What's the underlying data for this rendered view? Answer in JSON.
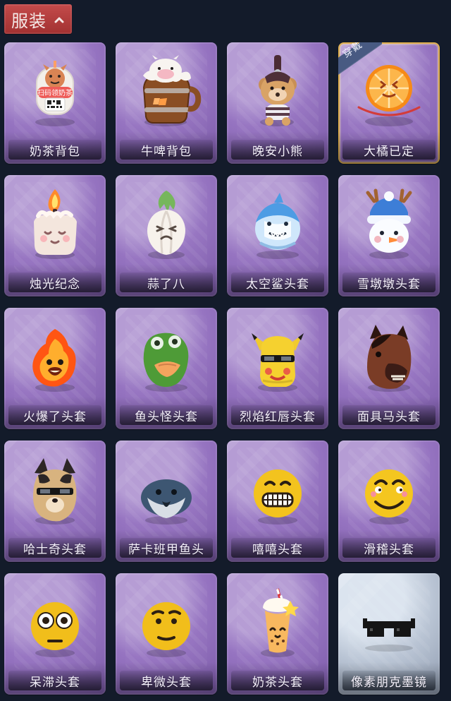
{
  "header": {
    "category_label": "服装",
    "caret_icon": "chevron-up-icon"
  },
  "grid": {
    "items": [
      {
        "label": "奶茶背包",
        "icon": "milk-tea-backpack-icon",
        "overlay_text": "扫码领奶茶"
      },
      {
        "label": "牛啤背包",
        "icon": "cow-beer-backpack-icon"
      },
      {
        "label": "晚安小熊",
        "icon": "bear-keychain-icon"
      },
      {
        "label": "大橘已定",
        "icon": "orange-slice-icon",
        "badge": "穿戴",
        "equipped": true
      },
      {
        "label": "烛光纪念",
        "icon": "candle-icon"
      },
      {
        "label": "蒜了八",
        "icon": "garlic-icon"
      },
      {
        "label": "太空鲨头套",
        "icon": "shark-helmet-icon"
      },
      {
        "label": "雪墩墩头套",
        "icon": "snowman-icon"
      },
      {
        "label": "火爆了头套",
        "icon": "flame-face-icon"
      },
      {
        "label": "鱼头怪头套",
        "icon": "fish-head-icon"
      },
      {
        "label": "烈焰红唇头套",
        "icon": "yellow-monster-icon"
      },
      {
        "label": "面具马头套",
        "icon": "horse-mask-icon"
      },
      {
        "label": "哈士奇头套",
        "icon": "husky-mask-icon"
      },
      {
        "label": "萨卡班甲鱼头",
        "icon": "sakabambaspis-icon"
      },
      {
        "label": "嘻嘻头套",
        "icon": "grin-emoji-icon"
      },
      {
        "label": "滑稽头套",
        "icon": "smirk-emoji-icon"
      },
      {
        "label": "呆滞头套",
        "icon": "stare-emoji-icon"
      },
      {
        "label": "卑微头套",
        "icon": "shy-emoji-icon"
      },
      {
        "label": "奶茶头套",
        "icon": "milk-tea-head-icon"
      },
      {
        "label": "像素朋克墨镜",
        "icon": "pixel-sunglasses-icon",
        "style": "alt"
      }
    ]
  }
}
